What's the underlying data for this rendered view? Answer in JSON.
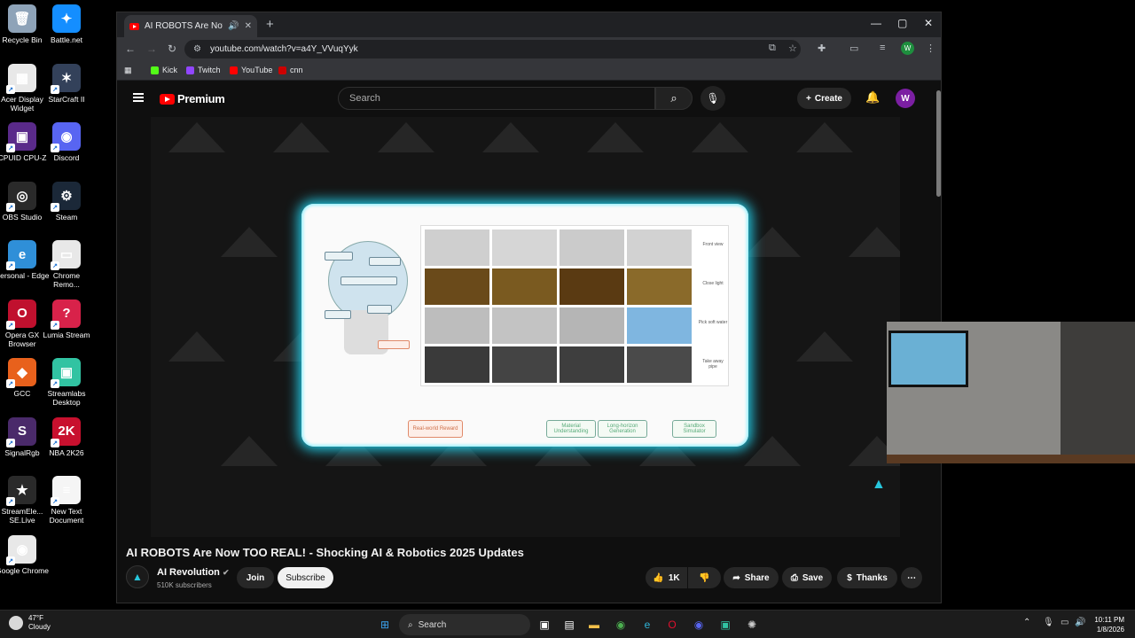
{
  "desktop": {
    "icons": [
      {
        "label": "Recycle Bin",
        "color": "#8ea3b8",
        "glyph": "🗑"
      },
      {
        "label": "Battle.net",
        "color": "#148eff",
        "glyph": "✦"
      },
      {
        "label": "Acer Display Widget",
        "color": "#e8e8e8",
        "glyph": "▦"
      },
      {
        "label": "StarCraft II",
        "color": "#33415a",
        "glyph": "✶"
      },
      {
        "label": "CPUID CPU-Z",
        "color": "#5a2a8a",
        "glyph": "▣"
      },
      {
        "label": "Discord",
        "color": "#5865f2",
        "glyph": "◉"
      },
      {
        "label": "OBS Studio",
        "color": "#2a2a2a",
        "glyph": "◎"
      },
      {
        "label": "Steam",
        "color": "#1b2838",
        "glyph": "⚙"
      },
      {
        "label": "Personal - Edge",
        "color": "#2f8fd8",
        "glyph": "e"
      },
      {
        "label": "Chrome Remo...",
        "color": "#e8e8e8",
        "glyph": "▭"
      },
      {
        "label": "Opera GX Browser",
        "color": "#c0102e",
        "glyph": "O"
      },
      {
        "label": "Lumia Stream",
        "color": "#d8224a",
        "glyph": "?"
      },
      {
        "label": "GCC",
        "color": "#e8611c",
        "glyph": "◆"
      },
      {
        "label": "Streamlabs Desktop",
        "color": "#31c3a2",
        "glyph": "▣"
      },
      {
        "label": "SignalRgb",
        "color": "#4a2a6a",
        "glyph": "S"
      },
      {
        "label": "NBA 2K26",
        "color": "#c8102e",
        "glyph": "2K"
      },
      {
        "label": "StreamEle... SE.Live",
        "color": "#2a2a2a",
        "glyph": "★"
      },
      {
        "label": "New Text Document",
        "color": "#f5f5f5",
        "glyph": "≡"
      },
      {
        "label": "Google Chrome",
        "color": "#e8e8e8",
        "glyph": "◉"
      }
    ]
  },
  "browser": {
    "tab_title": "AI ROBOTS Are Now TOO R",
    "url": "youtube.com/watch?v=a4Y_VVuqYyk",
    "bookmarks": [
      {
        "label": "Kick",
        "color": "#53fc18"
      },
      {
        "label": "Twitch",
        "color": "#9146ff"
      },
      {
        "label": "YouTube",
        "color": "#ff0000"
      },
      {
        "label": "cnn",
        "color": "#cc0000"
      }
    ],
    "profile_initial": "W"
  },
  "youtube": {
    "brand": "Premium",
    "search_placeholder": "Search",
    "create_label": "Create",
    "avatar_initial": "W",
    "video_title": "AI ROBOTS Are Now TOO REAL! - Shocking AI & Robotics 2025 Updates",
    "channel_name": "AI Revolution",
    "channel_subs": "510K subscribers",
    "join_label": "Join",
    "subscribe_label": "Subscribe",
    "likes": "1K",
    "share_label": "Share",
    "save_label": "Save",
    "thanks_label": "Thanks"
  },
  "slide": {
    "row_labels": [
      "Front view",
      "Close light",
      "Pick soft water",
      "Take away pipe"
    ],
    "bottom_boxes": [
      "Real-world Reward",
      "Material Understanding",
      "Long-horizon Generation",
      "Sandbox Simulator"
    ]
  },
  "taskbar": {
    "temp": "47°F",
    "condition": "Cloudy",
    "search_label": "Search",
    "time": "10:11 PM",
    "date": "1/8/2026"
  }
}
